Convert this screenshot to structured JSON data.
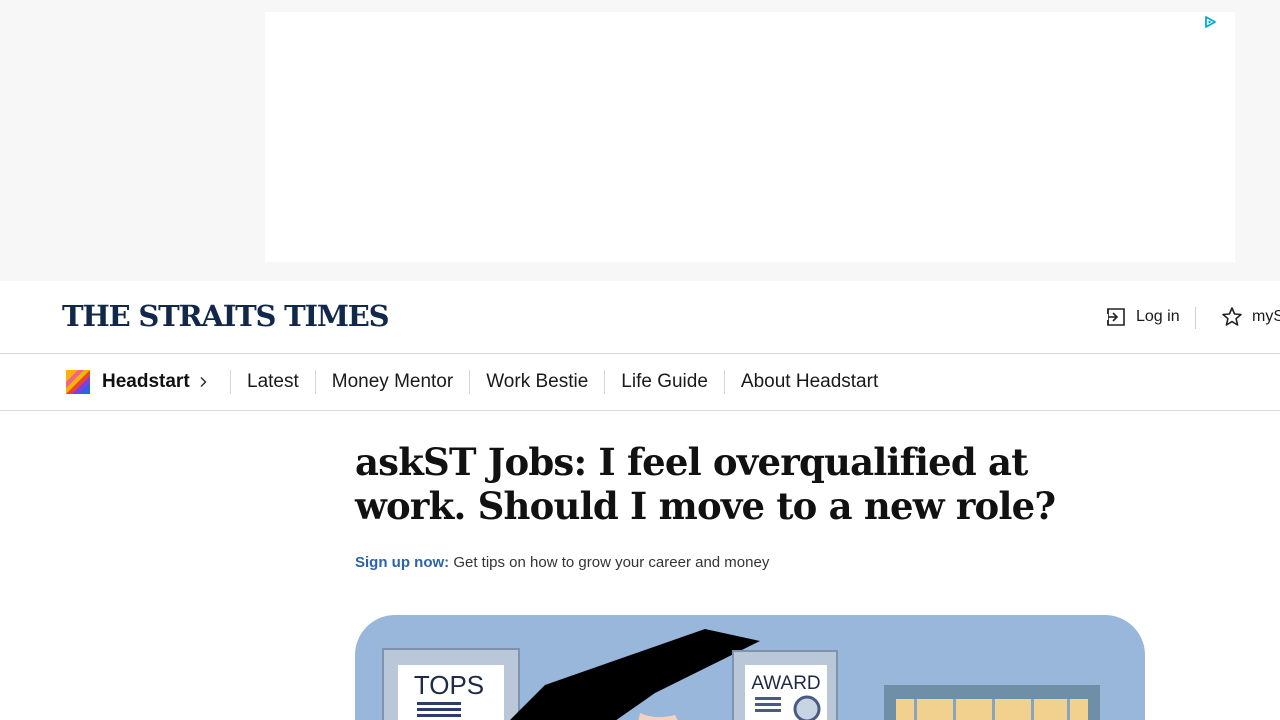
{
  "ad": {
    "adchoices_icon": "adchoices-icon"
  },
  "masthead": {
    "logo": "THE STRAITS TIMES",
    "login_label": "Log in",
    "login_icon": "login-icon",
    "myst_label": "myS",
    "myst_icon": "star-icon"
  },
  "section_nav": {
    "brand_label": "Headstart",
    "brand_icon": "headstart-logo-icon",
    "items": [
      {
        "label": "Latest"
      },
      {
        "label": "Money Mentor"
      },
      {
        "label": "Work Bestie"
      },
      {
        "label": "Life Guide"
      },
      {
        "label": "About Headstart"
      }
    ]
  },
  "article": {
    "headline": "askST Jobs: I feel overqualified at work. Should I move to a new role?",
    "signup_link": "Sign up now:",
    "signup_text": " Get tips on how to grow your career and money",
    "hero": {
      "sign_tops": "TOPS",
      "sign_award": "AWARD"
    }
  },
  "colors": {
    "brand_navy": "#12284b",
    "link_blue": "#2d63a8",
    "hero_bg": "#99b6db"
  }
}
